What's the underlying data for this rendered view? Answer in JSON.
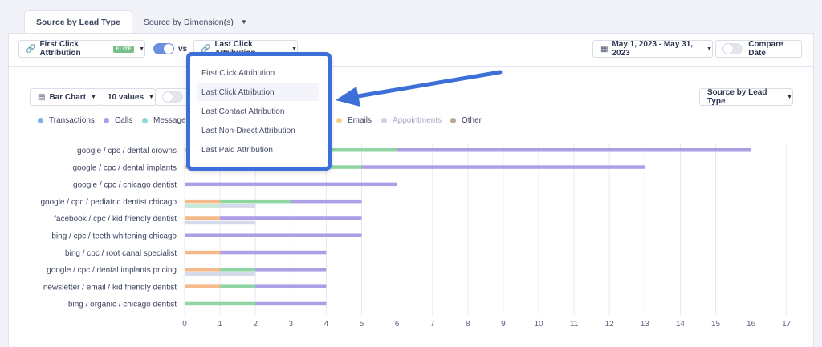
{
  "tabs": [
    {
      "label": "Source by Lead Type",
      "active": true
    },
    {
      "label": "Source by Dimension(s)",
      "active": false
    }
  ],
  "toolbar": {
    "attribution_left": "First Click Attribution",
    "elite_badge": "ELITE",
    "vs_label": "vs",
    "attribution_right": "Last Click Attribution",
    "date_range": "May 1, 2023 - May 31, 2023",
    "compare_label": "Compare Date",
    "compare_on": false
  },
  "controls": {
    "chart_type": "Bar Chart",
    "values_count": "10 values",
    "toggle_label_partial": "R",
    "group_by": "Source by Lead Type"
  },
  "dropdown": {
    "items": [
      "First Click Attribution",
      "Last Click Attribution",
      "Last Contact Attribution",
      "Last Non-Direct Attribution",
      "Last Paid Attribution"
    ],
    "highlighted": "Last Click Attribution"
  },
  "legend": [
    {
      "name": "Transactions",
      "color": "#7fb0e8"
    },
    {
      "name": "Calls",
      "color": "#ad9ee6"
    },
    {
      "name": "Messages",
      "color": "#8fd6d6"
    },
    {
      "name": "Emails",
      "color": "#f3cf8a"
    },
    {
      "name": "Appointments",
      "color": "#cbd2e8"
    },
    {
      "name": "Other",
      "color": "#b9ab8f"
    }
  ],
  "chart_data": {
    "type": "bar",
    "orientation": "horizontal",
    "stacked": true,
    "categories": [
      "google / cpc / dental crowns",
      "google / cpc / dental implants",
      "google / cpc / chicago dentist",
      "google / cpc / pediatric dentist chicago",
      "facebook / cpc / kid friendly dentist",
      "bing / cpc / teeth whitening chicago",
      "bing / cpc / root canal specialist",
      "google / cpc / dental implants pricing",
      "newsletter / email / kid friendly dentist",
      "bing / organic / chicago dentist"
    ],
    "xticks": [
      0,
      1,
      2,
      3,
      4,
      5,
      6,
      7,
      8,
      9,
      10,
      11,
      12,
      13,
      14,
      15,
      16,
      17
    ],
    "xlim": [
      0,
      17
    ],
    "grid": true,
    "bars": [
      {
        "row": 0,
        "lane": 0,
        "segments": [
          {
            "color": "#f5b98a",
            "value": 3
          },
          {
            "color": "#8fd6a3",
            "value": 3
          },
          {
            "color": "#ad9ee6",
            "value": 10
          }
        ]
      },
      {
        "row": 1,
        "lane": 0,
        "segments": [
          {
            "color": "#f5b98a",
            "value": 3
          },
          {
            "color": "#8fd6a3",
            "value": 2
          },
          {
            "color": "#ad9ee6",
            "value": 8
          }
        ]
      },
      {
        "row": 2,
        "lane": 0,
        "segments": [
          {
            "color": "#ad9ee6",
            "value": 6
          }
        ]
      },
      {
        "row": 3,
        "lane": 0,
        "segments": [
          {
            "color": "#f5b98a",
            "value": 1
          },
          {
            "color": "#8fd6a3",
            "value": 2
          },
          {
            "color": "#ad9ee6",
            "value": 2
          }
        ]
      },
      {
        "row": 3,
        "lane": 1,
        "segments": [
          {
            "color": "#c6e8d6",
            "value": 1
          },
          {
            "color": "#d6dbec",
            "value": 1
          }
        ]
      },
      {
        "row": 4,
        "lane": 0,
        "segments": [
          {
            "color": "#f5b98a",
            "value": 1
          },
          {
            "color": "#ad9ee6",
            "value": 4
          }
        ]
      },
      {
        "row": 4,
        "lane": 1,
        "segments": [
          {
            "color": "#d6dbec",
            "value": 2
          }
        ]
      },
      {
        "row": 5,
        "lane": 0,
        "segments": [
          {
            "color": "#ad9ee6",
            "value": 5
          }
        ]
      },
      {
        "row": 6,
        "lane": 0,
        "segments": [
          {
            "color": "#f5b98a",
            "value": 1
          },
          {
            "color": "#ad9ee6",
            "value": 3
          }
        ]
      },
      {
        "row": 7,
        "lane": 0,
        "segments": [
          {
            "color": "#f5b98a",
            "value": 1
          },
          {
            "color": "#8fd6a3",
            "value": 1
          },
          {
            "color": "#ad9ee6",
            "value": 2
          }
        ]
      },
      {
        "row": 7,
        "lane": 1,
        "segments": [
          {
            "color": "#d6dbec",
            "value": 2
          }
        ]
      },
      {
        "row": 8,
        "lane": 0,
        "segments": [
          {
            "color": "#f5b98a",
            "value": 1
          },
          {
            "color": "#8fd6a3",
            "value": 1
          },
          {
            "color": "#ad9ee6",
            "value": 2
          }
        ]
      },
      {
        "row": 9,
        "lane": 0,
        "segments": [
          {
            "color": "#8fd6a3",
            "value": 2
          },
          {
            "color": "#ad9ee6",
            "value": 2
          }
        ]
      }
    ]
  },
  "colors": {
    "accent": "#3d6fd8",
    "toggle_on": "#6c8fe0",
    "toggle_off": "#e2e5ec"
  }
}
